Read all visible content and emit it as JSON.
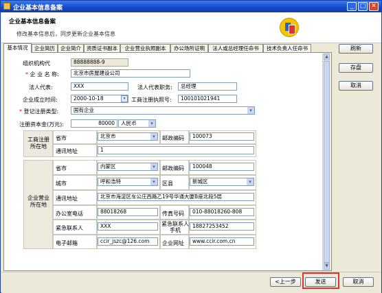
{
  "window": {
    "title": "企业基本信息备案"
  },
  "header": {
    "title": "企业基本信息备案",
    "subtitle": "修改基本信息后，同步更新企业基本信息"
  },
  "tabs": [
    "基本情况",
    "企业简历",
    "企业简介",
    "资质证书副本",
    "企业营业执照副本",
    "办公场所证明",
    "法人或总经理任命书",
    "技术负责人任命书"
  ],
  "form": {
    "org_code_label": "组织机构代",
    "org_code": "88888888-9",
    "name_label": "企 业 名 称:",
    "name": "北京市房屋建设公司",
    "legal_rep_label": "法人代表:",
    "legal_rep": "XXX",
    "legal_title_label": "法人代表职务:",
    "legal_title": "总经理",
    "est_date_label": "企业成立时间:",
    "est_date": "2000-10-18",
    "license_no_label": "工商注册执照号:",
    "license_no": "100101021941",
    "reg_type_label": "登记注册类型:",
    "reg_type": "国有企业",
    "capital_label": "注册资本金(万元):",
    "capital": "80000",
    "currency": "人民币"
  },
  "reg_location": {
    "section_label": "工商注册所在地",
    "province_label": "省市",
    "province": "北京市",
    "zip_label": "邮政编码",
    "zip": "100073",
    "address_label": "通讯地址",
    "address": "1"
  },
  "biz_location": {
    "section_label": "企业营业所在地",
    "province_label": "省市",
    "province": "内蒙区",
    "zip_label": "邮政编码",
    "zip": "100048",
    "city_label": "城市",
    "city": "呼和浩特",
    "district_label": "区县",
    "district": "新城区",
    "address_label": "通讯地址",
    "address": "北京市海淀区车公庄西路乙19号华通大厦B座北段5层",
    "phone_label": "办公室电话",
    "phone": "88018268",
    "fax_label": "传真号码",
    "fax": "010-88018260-808",
    "contact_label": "紧急联系人",
    "contact": "XXX",
    "contact_phone_label": "紧急联系人手机",
    "contact_phone": "18827253452",
    "email_label": "电子邮箱",
    "email": "ccir_jszc@126.com",
    "website_label": "企业网址",
    "website": "www.ccir.com.cn"
  },
  "side_buttons": {
    "refresh": "刷新",
    "save": "存盘",
    "cancel": "取消"
  },
  "bottom_buttons": {
    "prev": "<上一步",
    "send": "发送",
    "cancel": "取消"
  }
}
